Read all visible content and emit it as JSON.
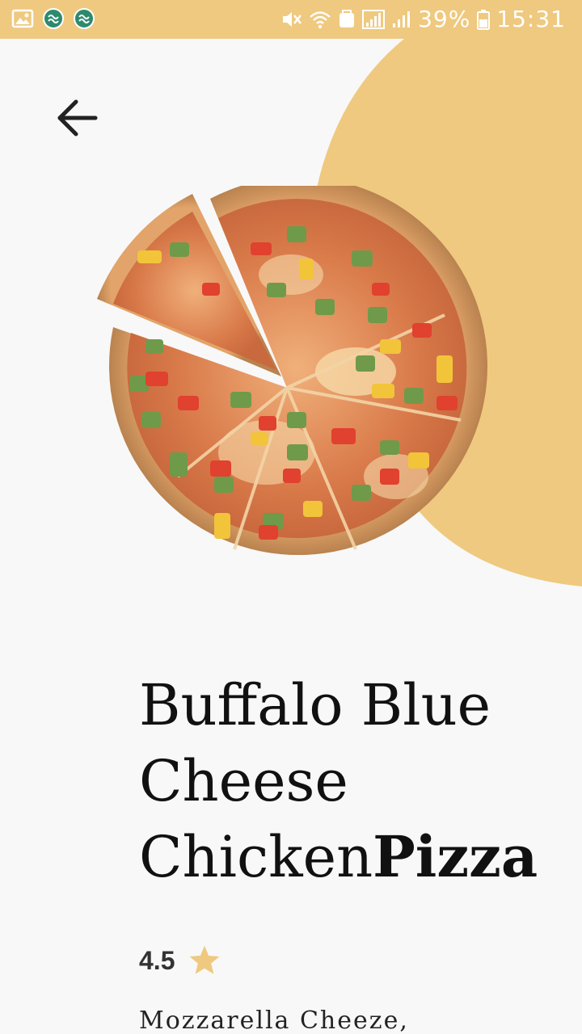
{
  "status_bar": {
    "battery_percent": "39%",
    "time": "15:31"
  },
  "header": {
    "back_icon": "arrow-left-icon"
  },
  "product": {
    "name_regular": "Buffalo Blue Cheese Chicken",
    "name_bold": "Pizza",
    "rating": "4.5",
    "rating_icon": "star-icon",
    "description": "Mozzarella Cheeze,"
  },
  "colors": {
    "accent": "#efc97f",
    "background": "#f8f8f8",
    "star": "#efc97f"
  }
}
